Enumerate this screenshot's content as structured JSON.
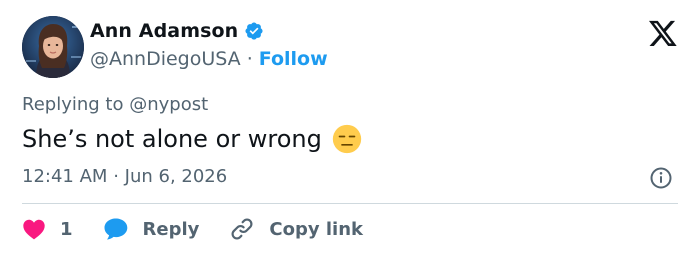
{
  "author": {
    "name": "Ann Adamson",
    "handle": "@AnnDiegoUSA",
    "separator": "·",
    "follow_label": "Follow",
    "verified": true
  },
  "reply": {
    "prefix": "Replying to ",
    "to": "@nypost"
  },
  "tweet": {
    "text": "She’s not alone or wrong",
    "emoji": "expressionless-face"
  },
  "meta": {
    "time": "12:41 AM",
    "dot": "·",
    "date": "Jun 6, 2026"
  },
  "actions": {
    "like_count": "1",
    "reply_label": "Reply",
    "copy_link_label": "Copy link"
  },
  "colors": {
    "accent": "#1d9bf0",
    "like": "#f91880",
    "text": "#0f1419",
    "muted": "#536471"
  }
}
